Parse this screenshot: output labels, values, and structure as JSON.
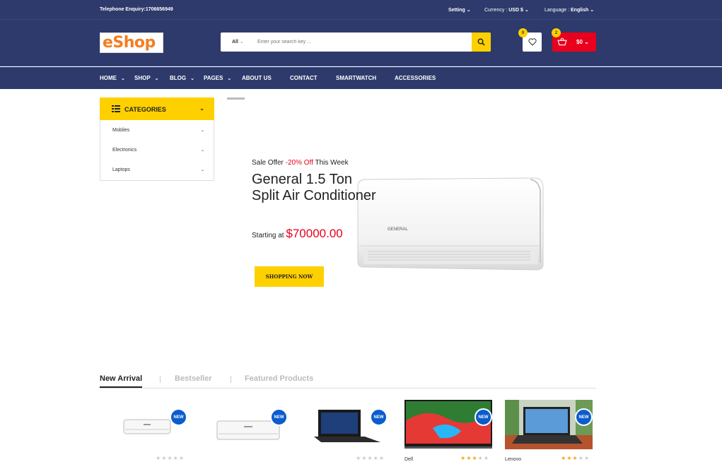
{
  "topbar": {
    "phone": "Telephone Enquiry:1706656949",
    "setting": "Setting",
    "currency_label": "Currency :",
    "currency_value": "USD $",
    "language_label": "Language :",
    "language_value": "English"
  },
  "header": {
    "logo": "eShop",
    "search_category": "All",
    "search_placeholder": "Enter your search key ...",
    "wishlist_count": "0",
    "cart_count": "2",
    "cart_total": "$0"
  },
  "nav": {
    "items": [
      {
        "label": "HOME",
        "dropdown": true
      },
      {
        "label": "SHOP",
        "dropdown": true
      },
      {
        "label": "BLOG",
        "dropdown": true
      },
      {
        "label": "PAGES",
        "dropdown": true
      },
      {
        "label": "ABOUT US",
        "dropdown": false
      },
      {
        "label": "CONTACT",
        "dropdown": false
      },
      {
        "label": "SMARTWATCH",
        "dropdown": false
      },
      {
        "label": "ACCESSORIES",
        "dropdown": false
      }
    ]
  },
  "categories": {
    "title": "CATEGORIES",
    "items": [
      "Mobiles",
      "Electronics",
      "Laptops"
    ]
  },
  "hero": {
    "sale_prefix": "Sale Offer",
    "sale_off": "-20% Off",
    "sale_suffix": "This Week",
    "title": "General 1.5 Ton Split Air Conditioner",
    "price_prefix": "Starting at",
    "price": "$70000.00",
    "cta": "SHOPPING NOW",
    "brand_on_unit": "GENERAL"
  },
  "tabs": [
    "New Arrival",
    "Bestseller",
    "Featured Products"
  ],
  "products": [
    {
      "badge": "NEW",
      "brand": "",
      "rating": 0
    },
    {
      "badge": "NEW",
      "brand": "",
      "rating": 0
    },
    {
      "badge": "NEW",
      "brand": "",
      "rating": 0
    },
    {
      "badge": "NEW",
      "brand": "Dell",
      "rating": 3
    },
    {
      "badge": "NEW",
      "brand": "Lenovo",
      "rating": 3
    }
  ],
  "colors": {
    "navy": "#2d3a6b",
    "yellow": "#ffd000",
    "red": "#e8001c",
    "badge_blue": "#0b5ccd",
    "logo_orange": "#f37e21"
  }
}
